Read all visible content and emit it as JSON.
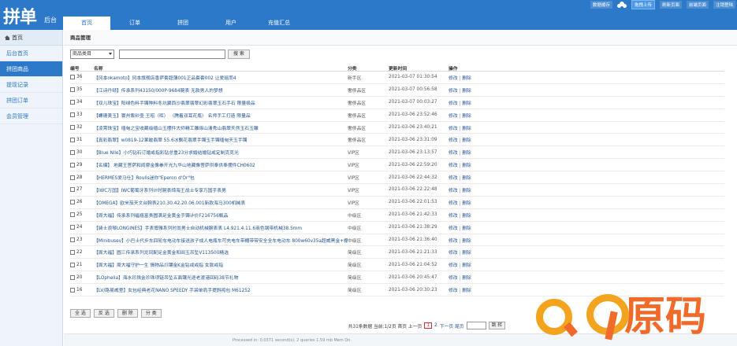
{
  "header": {
    "logo_text": "拼单",
    "logo_sub": "后台",
    "nav": [
      "首页",
      "订单",
      "拼团",
      "用户",
      "充值汇总"
    ],
    "top_links": [
      "数据缓存",
      "拖拽上传",
      "刷新页面",
      "前端页面",
      "注销登陆"
    ]
  },
  "sidebar": {
    "title": "首页",
    "items": [
      "后台首页",
      "拼团商品",
      "提现记录",
      "拼团订单",
      "会员管理"
    ]
  },
  "main": {
    "breadcrumb": "商品管理",
    "filter": {
      "select_value": "商品类目",
      "search_button": "搜 索"
    },
    "table": {
      "headers": [
        "编号",
        "名称",
        "分类",
        "更新时间",
        "操作"
      ],
      "op_edit": "修改",
      "op_delete": "删除",
      "rows": [
        {
          "id": "36",
          "name": "【冈本okamoto】冈本旗舰店香萨套超薄001正品套套002 让爱瑶而4",
          "cat": "新手区",
          "time": "2021-03-07 01:30:54"
        },
        {
          "id": "35",
          "name": "【江诗丹顿】传承系列43150/000P-9684腕表 无款男人的梦想",
          "cat": "奢侈品区",
          "time": "2021-03-07 00:56:58"
        },
        {
          "id": "34",
          "name": "【双儿珠宝】阳绿色料手镯种料冬坑翼西沙翡翠翡翠幻彩翡翠玉石手石 限量极品",
          "cat": "奢侈品区",
          "time": "2021-03-07 00:03:27"
        },
        {
          "id": "33",
          "name": "【螺珊美玉】寰州紫砂壶 王昭（晖） （腾着双耳花瓶） 名师手工打造 限量品",
          "cat": "奢侈品区",
          "time": "2021-03-06 23:52:46"
        },
        {
          "id": "32",
          "name": "【凌霄珠宝】缅甸之宝收藏级缅山玉摆件大师精工雕琢山清秀山翡翠天然玉石玉雕",
          "cat": "奢侈品区",
          "time": "2021-03-06 23:40:21"
        },
        {
          "id": "31",
          "name": "【真彩翡翠】w0819-12果敢翡翠 55.6冰飘花翡翠手镯玉手镯缅甸天玉手镯",
          "cat": "奢侈品区",
          "time": "2021-03-06 23:31:09"
        },
        {
          "id": "30",
          "name": "【Blue Nile】小巧钻石订婚戒指彩钻总重23分求婚结婚钻戒定制克克光",
          "cat": "VIP区",
          "time": "2021-03-06 23:13:57"
        },
        {
          "id": "29",
          "name": "【名爆】 地藏王菩萨和阎摩金像拳开光九华山地藏像菩萨供奉供奉摆件CH0602",
          "cat": "VIP区",
          "time": "2021-03-06 22:59:20"
        },
        {
          "id": "28",
          "name": "【HERMES爱马仕】Roulis迷你\"Eperon d'Or\"包",
          "cat": "VIP区",
          "time": "2021-03-06 22:44:32"
        },
        {
          "id": "27",
          "name": "【IWC万国】IWC葡萄牙系列计时腕表缔海王战士专享万国手表男",
          "cat": "VIP区",
          "time": "2021-03-06 22:22:48"
        },
        {
          "id": "26",
          "name": "【OMEGA】欧米茄天文台腕表210.30.42.20.06.001新款海马300机械表",
          "cat": "VIP区",
          "time": "2021-03-06 22:01:53"
        },
        {
          "id": "25",
          "name": "【周大福】传承系列福禧富贵圆满足金黄金手镯计价F216756甄品",
          "cat": "中级区",
          "time": "2021-03-06 21:42:33"
        },
        {
          "id": "24",
          "name": "【骑士浪琴LONGINES】手表博雅系列时尚男士自动机械腕表表 L4.921.4.11.6商色钢带机械38.5mm",
          "cat": "中级区",
          "time": "2021-03-06 21:38:29"
        },
        {
          "id": "23",
          "name": "【Minibusev】小巴士代步车四轮车电动车接送孩子成人电瓶车可充电车带棚带带安全全车电动车 800w60v35a超威黑金+棚P中级区",
          "cat": "中级区",
          "time": "2021-03-06 21:36:40"
        },
        {
          "id": "22",
          "name": "【周大福】圆三传承系列龙凤配足金黄金和田玉吊坠V113500精选",
          "cat": "简级区",
          "time": "2021-03-06 21:21:33"
        },
        {
          "id": "21",
          "name": "【周大福】周大福守护一生 情物品爪镶金K金钻戒戒指 女款戒指",
          "cat": "简级区",
          "time": "2021-03-06 21:04:52"
        },
        {
          "id": "20",
          "name": "【LOphelia】海水珍珠金珍珠项链吊坠五面镶光逐老渡港回码38节礼物",
          "cat": "简级区",
          "time": "2021-03-06 20:45:47"
        },
        {
          "id": "16",
          "name": "【LV/路易威登】女包经典老花NANO SPEEDY 手袋单肩手提斜挎包 M61252",
          "cat": "简级区",
          "time": "2021-03-06 20:30:23"
        }
      ]
    },
    "bottom_buttons": [
      "全 选",
      "反 选",
      "删 除",
      "分 类"
    ],
    "pager": {
      "summary": "共31条数据 当前:1/2页 首页 上一页",
      "page1": "1",
      "page2": "2",
      "next": "下一页 尾页",
      "go_button": "跳 转"
    },
    "footer": "Processed in: 0.0371 second(s), 2 queries 1.59 mb Mem On."
  },
  "watermark": {
    "text": "Q9原码"
  },
  "colors": {
    "primary": "#2b79c8",
    "watermark_orange": "#f06a2a"
  }
}
